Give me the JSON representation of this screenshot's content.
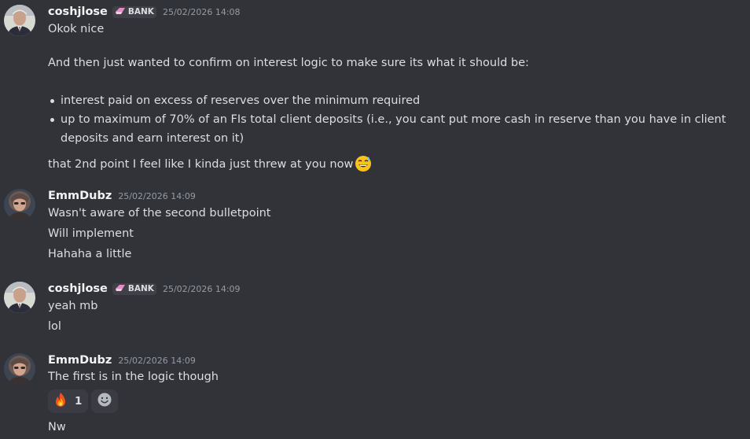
{
  "messages": [
    {
      "username": "coshjlose",
      "role_tag": "BANK",
      "timestamp": "25/02/2026 14:08",
      "line1": "Okok nice",
      "line2": "And then just wanted to confirm on interest logic to make sure its what it should be:",
      "bullets": [
        "interest paid on excess of reserves over the minimum required",
        "up to maximum of 70% of an FIs total client deposits (i.e., you cant put more cash in reserve than you have in client deposits and earn interest on it)"
      ],
      "line3": "that 2nd point I feel like I kinda just threw at you now",
      "line3_emoji": "sweat-smile-emoji"
    },
    {
      "username": "EmmDubz",
      "timestamp": "25/02/2026 14:09",
      "lines": [
        "Wasn't aware of the second bulletpoint",
        "Will implement",
        "Hahaha a little"
      ]
    },
    {
      "username": "coshjlose",
      "role_tag": "BANK",
      "timestamp": "25/02/2026 14:09",
      "lines": [
        "yeah mb",
        "lol"
      ]
    },
    {
      "username": "EmmDubz",
      "timestamp": "25/02/2026 14:09",
      "line1": "The first is in the logic though",
      "reaction": {
        "emoji": "fire-emoji",
        "count": "1"
      },
      "add_reaction_icon": "add-reaction-icon",
      "line2": "Nw"
    }
  ],
  "colors": {
    "background": "#323339",
    "text": "#dbdee1",
    "username": "#f2f3f5",
    "timestamp": "#949ba4",
    "tag_bg": "#3f4048"
  }
}
